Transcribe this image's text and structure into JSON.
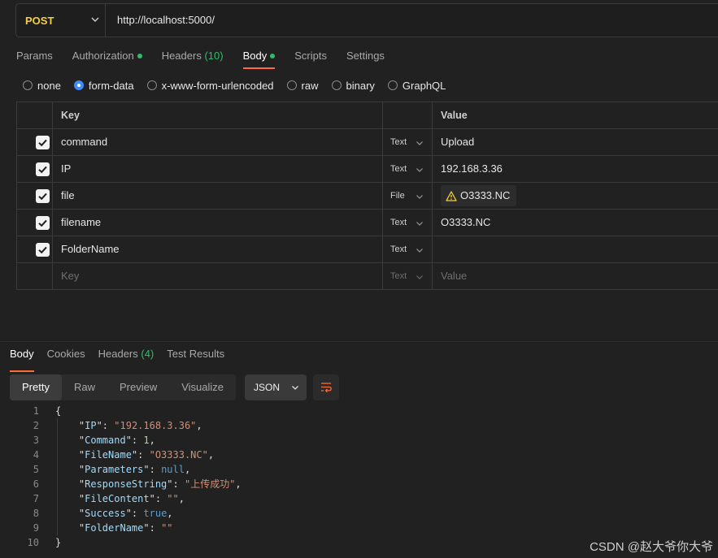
{
  "request": {
    "method": "POST",
    "url": "http://localhost:5000/"
  },
  "request_tabs": [
    {
      "label": "Params"
    },
    {
      "label": "Authorization",
      "dot": true
    },
    {
      "label": "Headers",
      "count": "(10)"
    },
    {
      "label": "Body",
      "dot": true,
      "active": true
    },
    {
      "label": "Scripts"
    },
    {
      "label": "Settings"
    }
  ],
  "body_types": [
    {
      "label": "none",
      "checked": false
    },
    {
      "label": "form-data",
      "checked": true
    },
    {
      "label": "x-www-form-urlencoded",
      "checked": false
    },
    {
      "label": "raw",
      "checked": false
    },
    {
      "label": "binary",
      "checked": false
    },
    {
      "label": "GraphQL",
      "checked": false
    }
  ],
  "form_table": {
    "key_header": "Key",
    "value_header": "Value",
    "rows": [
      {
        "key": "command",
        "type": "Text",
        "value": "Upload"
      },
      {
        "key": "IP",
        "type": "Text",
        "value": "192.168.3.36"
      },
      {
        "key": "file",
        "type": "File",
        "value": "O3333.NC"
      },
      {
        "key": "filename",
        "type": "Text",
        "value": "O3333.NC"
      },
      {
        "key": "FolderName",
        "type": "Text",
        "value": ""
      }
    ],
    "placeholder": {
      "key": "Key",
      "type": "Text",
      "value": "Value"
    }
  },
  "response_tabs": [
    {
      "label": "Body",
      "active": true
    },
    {
      "label": "Cookies"
    },
    {
      "label": "Headers",
      "count": "(4)"
    },
    {
      "label": "Test Results"
    }
  ],
  "view_modes": [
    "Pretty",
    "Raw",
    "Preview",
    "Visualize"
  ],
  "format": "JSON",
  "response_lines": [
    {
      "n": "1",
      "text": "{"
    },
    {
      "n": "2",
      "key": "IP",
      "val": "\"192.168.3.36\"",
      "vtype": "s",
      "comma": true
    },
    {
      "n": "3",
      "key": "Command",
      "val": "1",
      "vtype": "n",
      "comma": true
    },
    {
      "n": "4",
      "key": "FileName",
      "val": "\"O3333.NC\"",
      "vtype": "s",
      "comma": true
    },
    {
      "n": "5",
      "key": "Parameters",
      "val": "null",
      "vtype": "kw",
      "comma": true
    },
    {
      "n": "6",
      "key": "ResponseString",
      "val": "\"上传成功\"",
      "vtype": "s",
      "comma": true
    },
    {
      "n": "7",
      "key": "FileContent",
      "val": "\"\"",
      "vtype": "s",
      "comma": true
    },
    {
      "n": "8",
      "key": "Success",
      "val": "true",
      "vtype": "kw",
      "comma": true
    },
    {
      "n": "9",
      "key": "FolderName",
      "val": "\"\"",
      "vtype": "s",
      "comma": false
    },
    {
      "n": "10",
      "text": "}"
    }
  ],
  "watermark": "CSDN @赵大爷你大爷",
  "colors": {
    "method": "#f4d03f",
    "accent": "#ff6c37",
    "status_dot": "#2ebd6b",
    "radio_checked": "#3f8cff"
  }
}
